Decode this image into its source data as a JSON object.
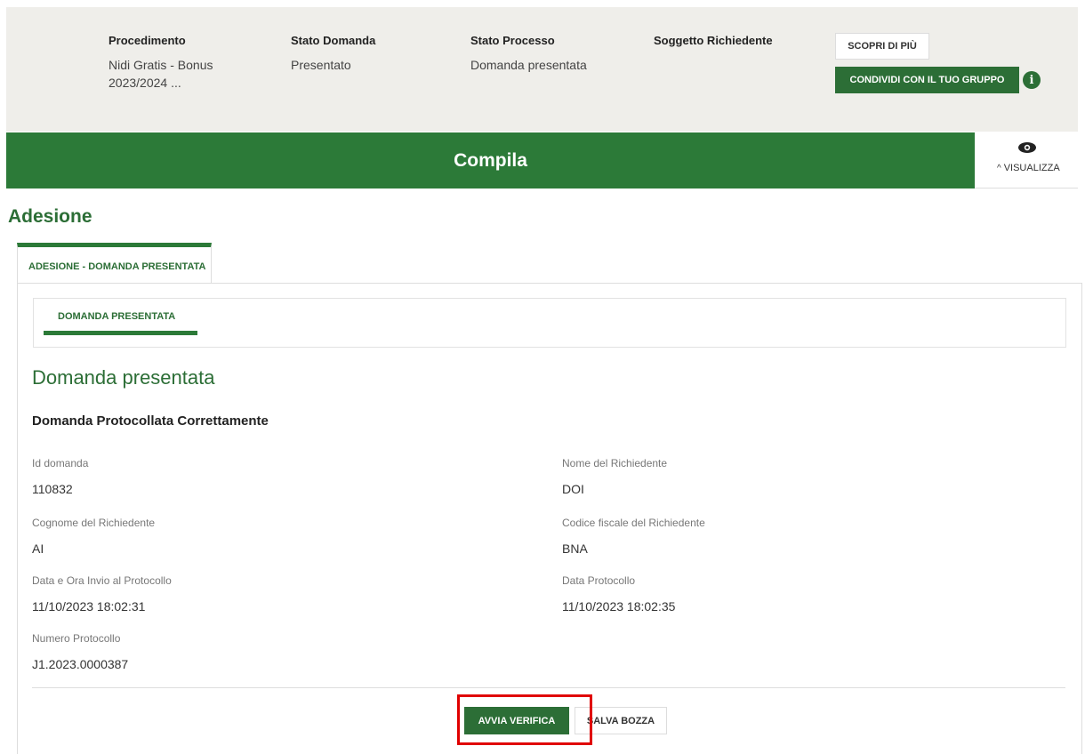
{
  "header": {
    "procedimento": {
      "label": "Procedimento",
      "value_line1": "Nidi Gratis - Bonus",
      "value_line2": "2023/2024 ..."
    },
    "stato_domanda": {
      "label": "Stato Domanda",
      "value": "Presentato"
    },
    "stato_processo": {
      "label": "Stato Processo",
      "value": "Domanda presentata"
    },
    "soggetto_richiedente": {
      "label": "Soggetto Richiedente",
      "value": ""
    },
    "scopri_label": "SCOPRI DI PIÙ",
    "condividi_label": "CONDIVIDI CON IL TUO GRUPPO",
    "info_icon": "info-icon",
    "info_glyph": "i"
  },
  "compila": {
    "title": "Compila",
    "visualizza_label": "VISUALIZZA",
    "caret_glyph": "^"
  },
  "section": {
    "title": "Adesione"
  },
  "outer_tab": {
    "label": "ADESIONE - DOMANDA PRESENTATA"
  },
  "inner_tab": {
    "label": "DOMANDA PRESENTATA"
  },
  "panel": {
    "title": "Domanda presentata",
    "subtitle": "Domanda Protocollata Correttamente",
    "fields": {
      "id_domanda": {
        "label": "Id domanda",
        "value": "110832"
      },
      "nome": {
        "label": "Nome del Richiedente",
        "value": "DOI"
      },
      "cognome": {
        "label": "Cognome del Richiedente",
        "value": "AI"
      },
      "codice_fiscale": {
        "label": "Codice fiscale del Richiedente",
        "value": "BNA"
      },
      "data_invio": {
        "label": "Data e Ora Invio al Protocollo",
        "value": "11/10/2023 18:02:31"
      },
      "data_protocollo": {
        "label": "Data Protocollo",
        "value": "11/10/2023 18:02:35"
      },
      "numero_protocollo": {
        "label": "Numero Protocollo",
        "value": "J1.2023.0000387"
      }
    }
  },
  "actions": {
    "avvia_label": "AVVIA VERIFICA",
    "salva_label": "SALVA BOZZA"
  },
  "colors": {
    "primary_green": "#2c7a38",
    "dark_green": "#2c6e36",
    "highlight": "#e00000",
    "band_bg": "#efeeea"
  }
}
